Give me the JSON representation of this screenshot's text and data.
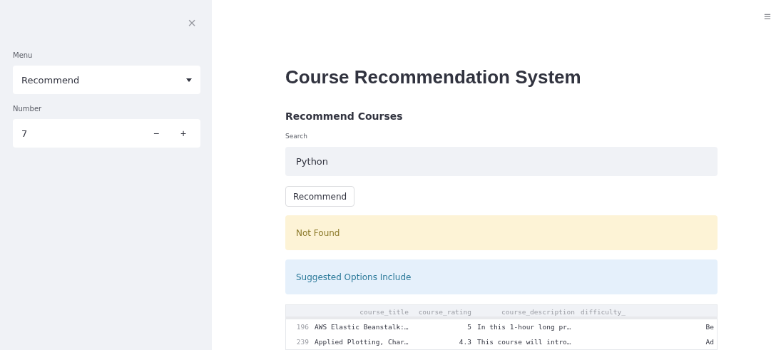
{
  "sidebar": {
    "close": "×",
    "menu": {
      "label": "Menu",
      "value": "Recommend"
    },
    "number": {
      "label": "Number",
      "value": "7",
      "decrement": "−",
      "increment": "+"
    }
  },
  "main": {
    "menu_button": "≡",
    "title": "Course Recommendation System",
    "subtitle": "Recommend Courses",
    "search": {
      "label": "Search",
      "value": "Python"
    },
    "button": "Recommend",
    "alerts": [
      {
        "kind": "warning",
        "text": "Not Found"
      },
      {
        "kind": "info",
        "text": "Suggested Options Include"
      }
    ],
    "table": {
      "columns": [
        "",
        "course_title",
        "course_rating",
        "course_description",
        "difficulty_"
      ],
      "rows": [
        [
          "196",
          "AWS Elastic Beanstalk:…",
          "5",
          "In this 1-hour long pr…",
          "Be"
        ],
        [
          "239",
          "Applied Plotting, Char…",
          "4.3",
          "This course will intro…",
          "Ad"
        ]
      ]
    }
  }
}
